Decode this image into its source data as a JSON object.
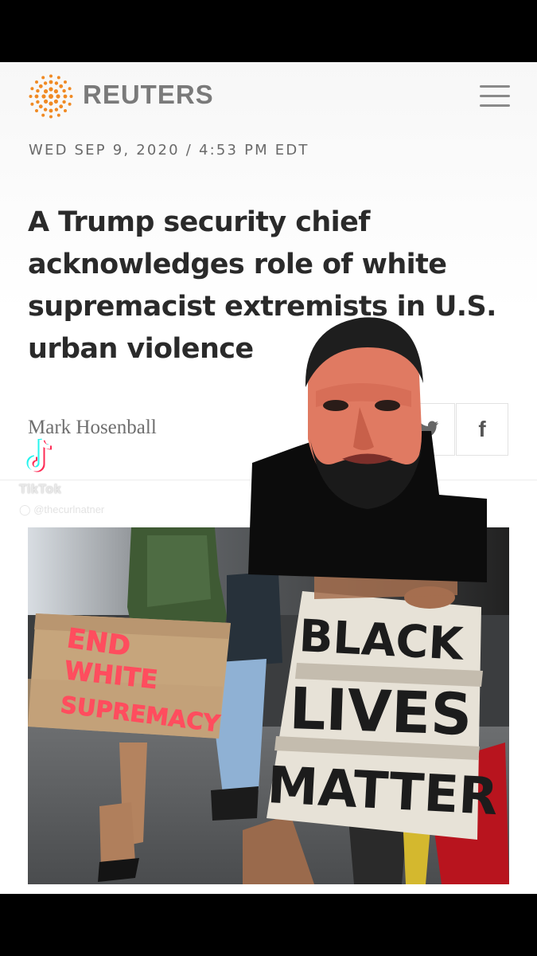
{
  "app": {
    "logo_text": "REUTERS",
    "menu_icon": "hamburger-menu-icon"
  },
  "article": {
    "dateline": "WED SEP 9, 2020 / 4:53 PM EDT",
    "headline": "A Trump security chief acknowledges role of white supremacist extremists in U.S. urban violence",
    "author": "Mark Hosenball"
  },
  "share": {
    "twitter_icon": "twitter-icon",
    "facebook_label": "f"
  },
  "watermark": {
    "brand": "TikTok",
    "handle": "@thecurlnatner"
  },
  "photo": {
    "sign_left": [
      "END",
      "WHITE",
      "SUPREMACY"
    ],
    "sign_right": [
      "BLACK",
      "LIVES",
      "MATTER"
    ]
  },
  "colors": {
    "background": "#000000",
    "page": "#ffffff",
    "logo_orange": "#f08a24",
    "headline_text": "#2a2a2a",
    "sign_red": "#ff3b4a"
  }
}
